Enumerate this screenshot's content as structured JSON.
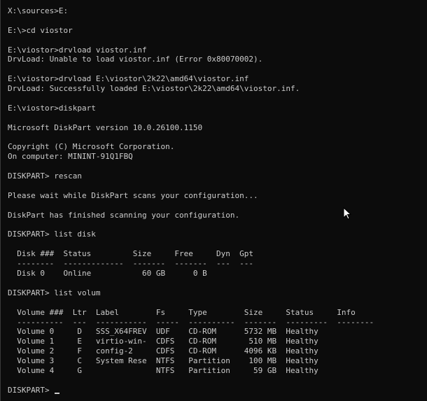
{
  "terminal": {
    "lines": [
      "X:\\sources>E:",
      "",
      "E:\\>cd viostor",
      "",
      "E:\\viostor>drvload viostor.inf",
      "DrvLoad: Unable to load viostor.inf (Error 0x80070002).",
      "",
      "E:\\viostor>drvload E:\\viostor\\2k22\\amd64\\viostor.inf",
      "DrvLoad: Successfully loaded E:\\viostor\\2k22\\amd64\\viostor.inf.",
      "",
      "E:\\viostor>diskpart",
      "",
      "Microsoft DiskPart version 10.0.26100.1150",
      "",
      "Copyright (C) Microsoft Corporation.",
      "On computer: MININT-91Q1FBQ",
      "",
      "DISKPART> rescan",
      "",
      "Please wait while DiskPart scans your configuration...",
      "",
      "DiskPart has finished scanning your configuration.",
      "",
      "DISKPART> list disk",
      "",
      "  Disk ###  Status         Size     Free     Dyn  Gpt",
      "  --------  -------------  -------  -------  ---  ---",
      "  Disk 0    Online           60 GB      0 B",
      "",
      "DISKPART> list volum",
      "",
      "  Volume ###  Ltr  Label        Fs     Type        Size     Status     Info",
      "  ----------  ---  -----------  -----  ----------  -------  ---------  --------",
      "  Volume 0     D   SSS_X64FREV  UDF    CD-ROM      5732 MB  Healthy",
      "  Volume 1     E   virtio-win-  CDFS   CD-ROM       510 MB  Healthy",
      "  Volume 2     F   config-2     CDFS   CD-ROM      4096 KB  Healthy",
      "  Volume 3     C   System Rese  NTFS   Partition    100 MB  Healthy",
      "  Volume 4     G                NTFS   Partition     59 GB  Healthy",
      "",
      "DISKPART> "
    ]
  },
  "colors": {
    "background": "#0c0c0c",
    "foreground": "#cccccc"
  },
  "icons": {
    "pointer": "mouse-pointer-icon",
    "cursor": "text-cursor-icon"
  }
}
